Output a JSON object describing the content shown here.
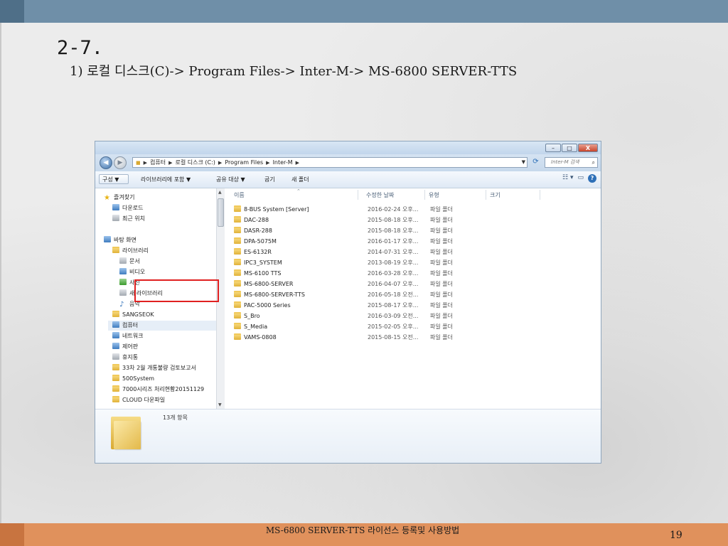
{
  "slide": {
    "title": "2-7.",
    "subtitle": "1) 로컬 디스크(C)-> Program Files-> Inter-M-> MS-6800 SERVER-TTS",
    "footer_text": "MS-6800 SERVER-TTS 라이선스 등록및 사용방법",
    "page_number": "19"
  },
  "window": {
    "buttons": {
      "minimize": "–",
      "maximize": "□",
      "close": "X"
    },
    "nav": {
      "back": "◀",
      "forward": "▶"
    },
    "breadcrumb": [
      "컴퓨터",
      "로컬 디스크 (C:)",
      "Program Files",
      "Inter-M"
    ],
    "search_placeholder": "Inter-M 검색",
    "toolbar": {
      "organize": "구성 ▼",
      "include_library": "라이브러리에 포함 ▼",
      "share": "공유 대상 ▼",
      "burn": "굽기",
      "new_folder": "새 폴더"
    },
    "nav_pane": [
      {
        "label": "즐겨찾기",
        "icon": "star-icon"
      },
      {
        "label": "다운로드",
        "icon": "download-folder-icon"
      },
      {
        "label": "최근 위치",
        "icon": "recent-places-icon"
      },
      {
        "label": "바탕 화면",
        "icon": "desktop-icon"
      },
      {
        "label": "라이브러리",
        "icon": "library-icon"
      },
      {
        "label": "문서",
        "icon": "documents-icon"
      },
      {
        "label": "비디오",
        "icon": "videos-icon"
      },
      {
        "label": "사진",
        "icon": "pictures-icon"
      },
      {
        "label": "새 라이브러리",
        "icon": "library-icon"
      },
      {
        "label": "음악",
        "icon": "music-icon"
      },
      {
        "label": "SANGSEOK",
        "icon": "user-folder-icon"
      },
      {
        "label": "컴퓨터",
        "icon": "computer-icon"
      },
      {
        "label": "네트워크",
        "icon": "network-icon"
      },
      {
        "label": "제어판",
        "icon": "control-panel-icon"
      },
      {
        "label": "휴지통",
        "icon": "recycle-bin-icon"
      },
      {
        "label": "33차 2월 개통불량 검토보고서",
        "icon": "folder-icon"
      },
      {
        "label": "500System",
        "icon": "folder-icon"
      },
      {
        "label": "7000시리즈 처리현황20151129",
        "icon": "folder-icon"
      },
      {
        "label": "CLOUD 다운파일",
        "icon": "folder-icon"
      }
    ],
    "columns": {
      "name": "이름",
      "date": "수정한 날짜",
      "type": "유형",
      "size": "크기"
    },
    "files": [
      {
        "name": "8-BUS System [Server]",
        "date": "2016-02-24 오후...",
        "type": "파일 폴더"
      },
      {
        "name": "DAC-288",
        "date": "2015-08-18 오후...",
        "type": "파일 폴더"
      },
      {
        "name": "DASR-288",
        "date": "2015-08-18 오후...",
        "type": "파일 폴더"
      },
      {
        "name": "DPA-5075M",
        "date": "2016-01-17 오후...",
        "type": "파일 폴더"
      },
      {
        "name": "ES-6132R",
        "date": "2014-07-31 오후...",
        "type": "파일 폴더"
      },
      {
        "name": "IPC3_SYSTEM",
        "date": "2013-08-19 오후...",
        "type": "파일 폴더"
      },
      {
        "name": "MS-6100 TTS",
        "date": "2016-03-28 오후...",
        "type": "파일 폴더"
      },
      {
        "name": "MS-6800-SERVER",
        "date": "2016-04-07 오후...",
        "type": "파일 폴더"
      },
      {
        "name": "MS-6800-SERVER-TTS",
        "date": "2016-05-18 오전...",
        "type": "파일 폴더"
      },
      {
        "name": "PAC-5000 Series",
        "date": "2015-08-17 오후...",
        "type": "파일 폴더"
      },
      {
        "name": "S_Bro",
        "date": "2016-03-09 오전...",
        "type": "파일 폴더"
      },
      {
        "name": "S_Media",
        "date": "2015-02-05 오후...",
        "type": "파일 폴더"
      },
      {
        "name": "VAMS-0808",
        "date": "2015-08-15 오전...",
        "type": "파일 폴더"
      }
    ],
    "status": {
      "item_count": "13개 항목"
    }
  }
}
